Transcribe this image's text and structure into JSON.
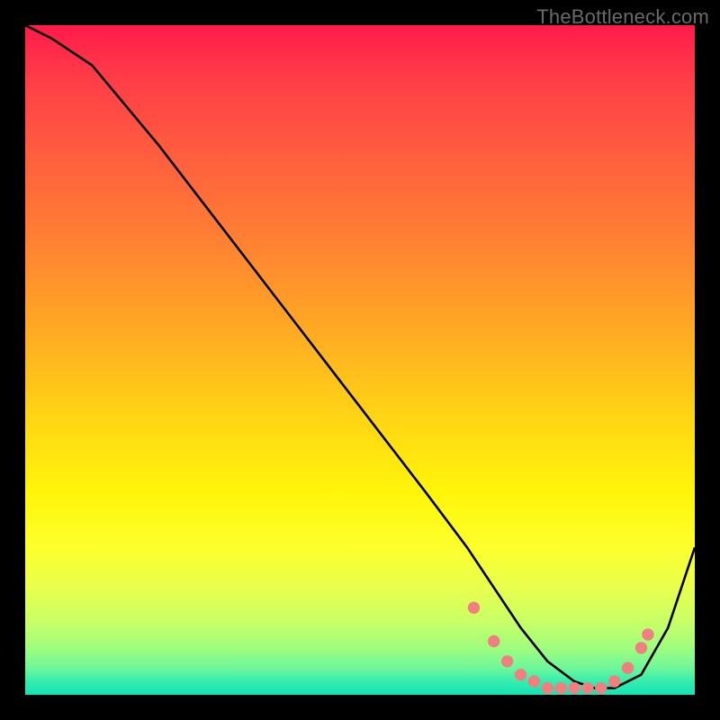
{
  "watermark": "TheBottleneck.com",
  "chart_data": {
    "type": "line",
    "title": "",
    "xlabel": "",
    "ylabel": "",
    "xlim": [
      0,
      100
    ],
    "ylim": [
      0,
      100
    ],
    "series": [
      {
        "name": "curve",
        "x": [
          0,
          4,
          10,
          20,
          30,
          40,
          50,
          60,
          66,
          70,
          74,
          78,
          82,
          85,
          88,
          92,
          96,
          100
        ],
        "values": [
          100,
          98,
          94,
          82,
          69,
          56,
          43,
          30,
          22,
          16,
          10,
          5,
          2,
          1,
          1,
          3,
          10,
          22
        ]
      }
    ],
    "markers": {
      "name": "dots",
      "color": "#f08080",
      "points": [
        {
          "x": 67,
          "y": 13
        },
        {
          "x": 70,
          "y": 8
        },
        {
          "x": 72,
          "y": 5
        },
        {
          "x": 74,
          "y": 3
        },
        {
          "x": 76,
          "y": 2
        },
        {
          "x": 78,
          "y": 1
        },
        {
          "x": 80,
          "y": 1
        },
        {
          "x": 82,
          "y": 1
        },
        {
          "x": 84,
          "y": 1
        },
        {
          "x": 86,
          "y": 1
        },
        {
          "x": 88,
          "y": 2
        },
        {
          "x": 90,
          "y": 4
        },
        {
          "x": 92,
          "y": 7
        },
        {
          "x": 93,
          "y": 9
        }
      ]
    },
    "gradient_stops": [
      {
        "pos": 0.0,
        "color": "#ff1a4b"
      },
      {
        "pos": 0.3,
        "color": "#ff7a35"
      },
      {
        "pos": 0.6,
        "color": "#ffd315"
      },
      {
        "pos": 0.8,
        "color": "#fdff2c"
      },
      {
        "pos": 1.0,
        "color": "#13e3b3"
      }
    ]
  }
}
